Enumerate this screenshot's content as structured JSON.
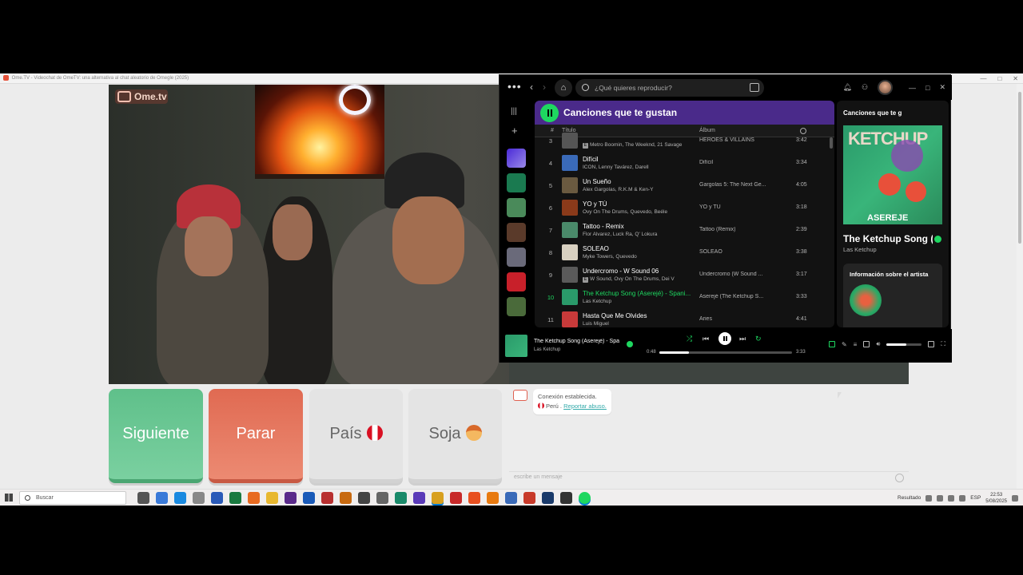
{
  "ome": {
    "window_title": "Ome.TV - Videochat de OmeTV: una alternativa al chat aleatorio de Omegle (2025)",
    "logo_text": "Ome.tv",
    "buttons": {
      "next": "Siguiente",
      "stop": "Parar",
      "country": "País",
      "gender": "Soja"
    },
    "chat": {
      "connection_text": "Conexión establecida.",
      "country": "Perú",
      "separator": " . ",
      "report_link": "Reportar abuso.",
      "input_placeholder": "escribe un mensaje"
    }
  },
  "spotify": {
    "search_placeholder": "¿Qué quieres reproducir?",
    "playlist_title": "Canciones que te gustan",
    "columns": {
      "number": "#",
      "title": "Título",
      "album": "Álbum"
    },
    "tracks": [
      {
        "num": "3",
        "title": "",
        "artists": "Metro Boomin, The Weeknd, 21 Savage",
        "explicit": true,
        "album": "HEROES & VILLAINS",
        "duration": "3:42",
        "art_color": "#555"
      },
      {
        "num": "4",
        "title": "Difícil",
        "artists": "ICON, Lenny Tavárez, Darell",
        "explicit": false,
        "album": "Difícil",
        "duration": "3:34",
        "art_color": "#3a6ab8"
      },
      {
        "num": "5",
        "title": "Un Sueño",
        "artists": "Alex Gargolas, R.K.M & Ken-Y",
        "explicit": false,
        "album": "Gargolas 5: The Next Ge...",
        "duration": "4:05",
        "art_color": "#6a5a40"
      },
      {
        "num": "6",
        "title": "YO y TÚ",
        "artists": "Ovy On The Drums, Quevedo, Beéle",
        "explicit": false,
        "album": "YO y TÚ",
        "duration": "3:18",
        "art_color": "#8a3a1a"
      },
      {
        "num": "7",
        "title": "Tattoo - Remix",
        "artists": "Flor Alvarez, Luck Ra, Q' Lokura",
        "explicit": false,
        "album": "Tattoo (Remix)",
        "duration": "2:39",
        "art_color": "#4a8a6a"
      },
      {
        "num": "8",
        "title": "SOLEAO",
        "artists": "Myke Towers, Quevedo",
        "explicit": false,
        "album": "SOLEAO",
        "duration": "3:38",
        "art_color": "#d8d0c0"
      },
      {
        "num": "9",
        "title": "Undercromo - W Sound 06",
        "artists": "W Sound, Ovy On The Drums, Dei V",
        "explicit": true,
        "album": "Undercromo (W Sound ...",
        "duration": "3:17",
        "art_color": "#5a5a5a"
      },
      {
        "num": "10",
        "title": "The Ketchup Song (Aserejé) - Spani...",
        "artists": "Las Ketchup",
        "explicit": false,
        "album": "Aserejé (The Ketchup S...",
        "duration": "3:33",
        "art_color": "#2a9a6a",
        "active": true
      },
      {
        "num": "11",
        "title": "Hasta Que Me Olvides",
        "artists": "Luis Miguel",
        "explicit": false,
        "album": "Aries",
        "duration": "4:41",
        "art_color": "#c83a3a"
      }
    ],
    "now_playing": {
      "panel_title": "Canciones que te g",
      "song": "The Ketchup Song (A",
      "artist": "Las Ketchup",
      "about_artist": "Información sobre el artista",
      "cover_text_top": "KETCHUP",
      "cover_text_bottom": "ASEREJE"
    },
    "player": {
      "title": "The Ketchup Song (Aserejé) - Spa",
      "artist": "Las Ketchup",
      "elapsed": "0:48",
      "total": "3:33",
      "progress_fraction": 0.225,
      "volume_fraction": 0.55
    }
  },
  "taskbar": {
    "search_label": "Buscar",
    "weather": "Resultado",
    "language": "ESP",
    "time": "22:53",
    "date": "5/08/2025"
  },
  "colors": {
    "spotify_green": "#1ed760",
    "next_button": "#6cc894",
    "stop_button": "#e67a62"
  }
}
